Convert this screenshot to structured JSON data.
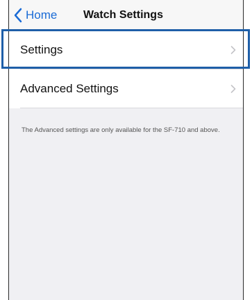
{
  "nav": {
    "back_label": "Home",
    "title": "Watch Settings"
  },
  "rows": [
    {
      "label": "Settings"
    },
    {
      "label": "Advanced Settings"
    }
  ],
  "footer": {
    "note": "The Advanced settings are only available for the SF-710 and above."
  },
  "colors": {
    "accent": "#1a6bd6",
    "highlight": "#1f5fa8",
    "background": "#f0f0f3"
  }
}
